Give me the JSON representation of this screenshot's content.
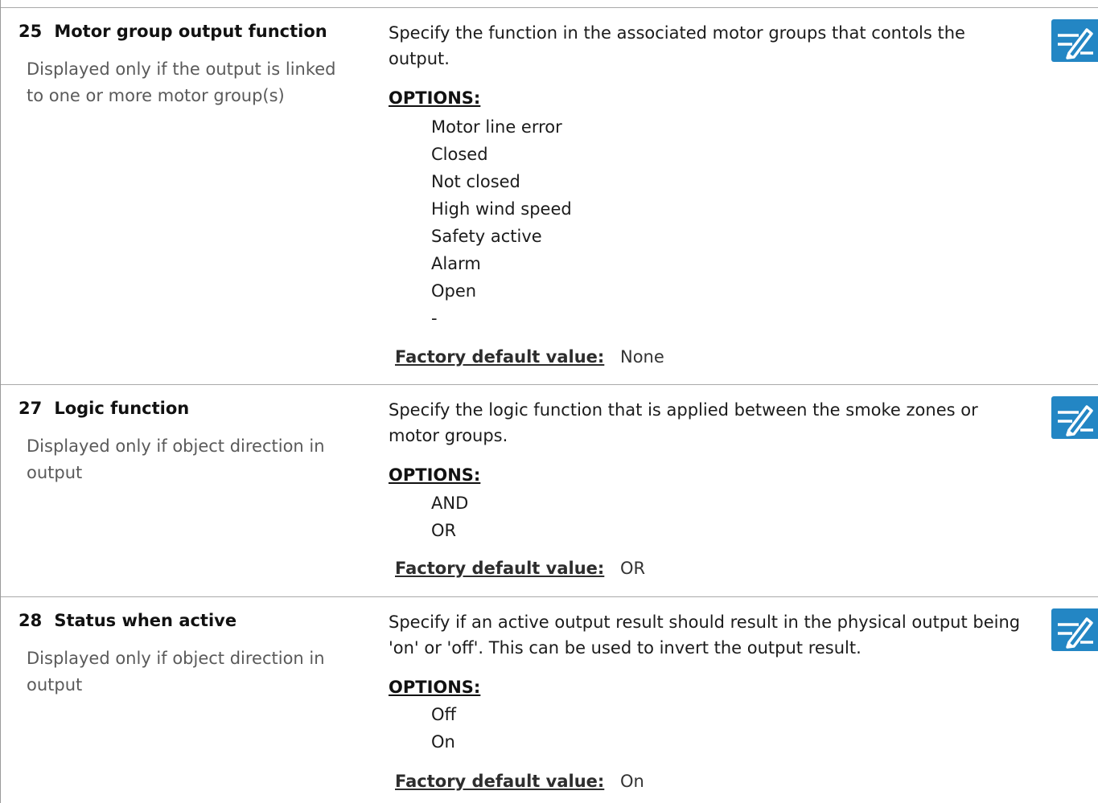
{
  "entries": [
    {
      "number": "25",
      "title": "Motor group output function",
      "note": "Displayed only if the output is linked to one or more motor group(s)",
      "description": "Specify the function in the associated motor groups that contols the output.",
      "options_heading": "OPTIONS:",
      "options": [
        "Motor line error",
        "Closed",
        "Not closed",
        "High wind speed",
        "Safety active",
        "Alarm",
        "Open",
        "-"
      ],
      "default_label": "Factory default value:",
      "default_value": "None",
      "edit_icon": "edit-pencil-icon"
    },
    {
      "number": "27",
      "title": "Logic function",
      "note": "Displayed only if object direction in output",
      "description": "Specify the logic function that is applied between the smoke zones or motor groups.",
      "options_heading": "OPTIONS:",
      "options": [
        "AND",
        "OR"
      ],
      "default_label": "Factory default value:",
      "default_value": "OR",
      "edit_icon": "edit-pencil-icon"
    },
    {
      "number": "28",
      "title": "Status when active",
      "note": "Displayed only if object direction in output",
      "description": "Specify if an active output result should result in the physical output being 'on' or 'off'. This can be used to invert the output result.",
      "options_heading": "OPTIONS:",
      "options": [
        "Off",
        "On"
      ],
      "default_label": "Factory default value:",
      "default_value": "On",
      "edit_icon": "edit-pencil-icon"
    }
  ],
  "colors": {
    "icon_background": "#2386c4",
    "icon_foreground": "#ffffff",
    "note_text": "#5a5a5a",
    "divider": "#a9a9a9"
  }
}
